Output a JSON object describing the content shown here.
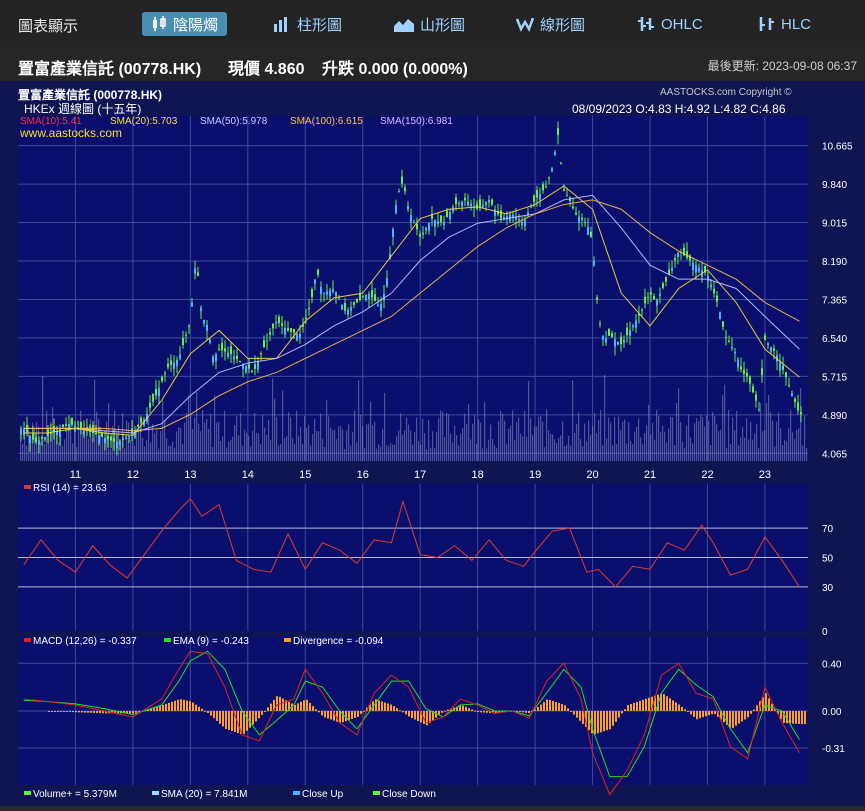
{
  "app": {
    "title": "圖表顯示"
  },
  "tabs": [
    {
      "label": "陰陽燭",
      "icon": "candlestick-icon",
      "active": true
    },
    {
      "label": "柱形圖",
      "icon": "bar-chart-icon",
      "active": false
    },
    {
      "label": "山形圖",
      "icon": "mountain-chart-icon",
      "active": false
    },
    {
      "label": "線形圖",
      "icon": "line-chart-icon",
      "active": false
    },
    {
      "label": "OHLC",
      "icon": "ohlc-icon",
      "active": false
    },
    {
      "label": "HLC",
      "icon": "hlc-icon",
      "active": false
    }
  ],
  "info": {
    "name": "置富產業信託 (00778.HK)",
    "price": "現價 4.860",
    "change": "升跌 0.000 (0.000%)",
    "updated": "最後更新: 2023-09-08 06:37"
  },
  "chart_header": {
    "title": "置富產業信託 (000778.HK)",
    "subtitle": "HKEx 週線圖 (十五年)",
    "source": "AASTOCKS.com Copyright ©",
    "website": "www.aastocks.com",
    "ohlc": "08/09/2023   O:4.83  H:4.92  L:4.82  C:4.86"
  },
  "colors": {
    "background": "#0f1550",
    "grid": "#3a4a9a",
    "candle": "#66ee44",
    "volume": "#8a8ab8",
    "sma10": "#ff3030",
    "sma20": "#ffdd33",
    "sma50": "#c8c8ff",
    "sma100": "#ffc040",
    "sma150": "#e0b0ff",
    "rsi": "#e03a2a",
    "macd": "#e02020",
    "ema": "#22dd22",
    "divergence": "#ffa020"
  },
  "chart_data": [
    {
      "type": "line",
      "panel": "price",
      "ylim": [
        3.9,
        11.3
      ],
      "yticks": [
        "10.665",
        "9.840",
        "9.015",
        "8.190",
        "7.365",
        "6.540",
        "5.715",
        "4.890",
        "4.065"
      ],
      "xticks": [
        "11",
        "12",
        "13",
        "14",
        "15",
        "16",
        "17",
        "18",
        "19",
        "20",
        "21",
        "22",
        "23"
      ],
      "legend": [
        "SMA(10):5.41",
        "SMA(20):5.703",
        "SMA(50):5.978",
        "SMA(100):6.615",
        "SMA(150):6.981"
      ],
      "series": [
        {
          "name": "Price",
          "x": [
            10.1,
            10.3,
            10.6,
            10.9,
            11.1,
            11.3,
            11.5,
            11.7,
            11.9,
            12.0,
            12.2,
            12.4,
            12.6,
            12.8,
            12.9,
            13.0,
            13.1,
            13.2,
            13.3,
            13.4,
            13.5,
            13.7,
            13.9,
            14.1,
            14.3,
            14.5,
            14.7,
            14.9,
            15.0,
            15.1,
            15.2,
            15.3,
            15.5,
            15.7,
            15.9,
            16.1,
            16.3,
            16.4,
            16.5,
            16.6,
            16.7,
            16.8,
            17.0,
            17.2,
            17.4,
            17.6,
            17.8,
            18.0,
            18.2,
            18.4,
            18.6,
            18.8,
            18.9,
            19.0,
            19.2,
            19.3,
            19.4,
            19.5,
            19.6,
            19.7,
            19.8,
            19.9,
            20.0,
            20.1,
            20.2,
            20.3,
            20.4,
            20.5,
            20.6,
            20.8,
            21.0,
            21.1,
            21.3,
            21.5,
            21.7,
            21.9,
            22.0,
            22.2,
            22.3,
            22.5,
            22.6,
            22.7,
            22.9,
            23.0,
            23.2,
            23.4,
            23.6
          ],
          "values": [
            4.6,
            4.3,
            4.5,
            4.7,
            4.6,
            4.5,
            4.4,
            4.3,
            4.4,
            4.5,
            4.8,
            5.3,
            5.9,
            6.1,
            6.5,
            6.9,
            8.3,
            7.0,
            6.8,
            6.1,
            6.3,
            6.2,
            6.0,
            5.8,
            6.4,
            6.9,
            6.7,
            6.6,
            6.9,
            7.3,
            8.0,
            7.5,
            7.6,
            7.1,
            7.3,
            7.5,
            7.2,
            7.6,
            8.6,
            9.6,
            9.9,
            9.3,
            8.7,
            9.1,
            9.0,
            9.4,
            9.5,
            9.3,
            9.5,
            9.1,
            9.2,
            9.0,
            9.3,
            9.5,
            9.8,
            10.2,
            10.9,
            9.7,
            9.5,
            9.2,
            9.1,
            9.0,
            8.6,
            7.0,
            6.5,
            6.6,
            6.5,
            6.4,
            6.6,
            7.0,
            7.5,
            7.3,
            7.8,
            8.4,
            8.2,
            8.0,
            7.9,
            7.2,
            6.6,
            6.2,
            5.8,
            5.7,
            5.0,
            6.5,
            6.2,
            5.6,
            4.9
          ]
        },
        {
          "name": "SMA(20)",
          "x": [
            10.1,
            10.5,
            11.0,
            11.5,
            12.0,
            12.5,
            13.0,
            13.5,
            14.0,
            14.5,
            15.0,
            15.5,
            16.0,
            16.5,
            17.0,
            17.5,
            18.0,
            18.5,
            19.0,
            19.5,
            20.0,
            20.5,
            21.0,
            21.5,
            22.0,
            22.5,
            23.0,
            23.6
          ],
          "values": [
            4.5,
            4.5,
            4.6,
            4.5,
            4.45,
            5.2,
            6.2,
            6.7,
            6.1,
            6.1,
            6.9,
            7.4,
            7.5,
            8.3,
            9.1,
            9.3,
            9.35,
            9.2,
            9.4,
            9.8,
            9.3,
            7.5,
            6.8,
            7.6,
            8.0,
            7.3,
            6.3,
            5.7
          ]
        },
        {
          "name": "SMA(50)",
          "x": [
            10.1,
            10.5,
            11.0,
            11.5,
            12.0,
            12.5,
            13.0,
            13.5,
            14.0,
            14.5,
            15.0,
            15.5,
            16.0,
            16.5,
            17.0,
            17.5,
            18.0,
            18.5,
            19.0,
            19.5,
            20.0,
            20.5,
            21.0,
            21.5,
            22.0,
            22.5,
            23.0,
            23.6
          ],
          "values": [
            4.6,
            4.6,
            4.6,
            4.55,
            4.5,
            4.7,
            5.3,
            5.8,
            6.0,
            6.1,
            6.4,
            6.8,
            7.1,
            7.5,
            8.2,
            8.7,
            9.0,
            9.1,
            9.2,
            9.5,
            9.6,
            8.9,
            8.1,
            7.8,
            7.8,
            7.6,
            7.0,
            6.3
          ]
        },
        {
          "name": "SMA(100)",
          "x": [
            10.1,
            10.5,
            11.0,
            11.5,
            12.0,
            12.5,
            13.0,
            13.5,
            14.0,
            14.5,
            15.0,
            15.5,
            16.0,
            16.5,
            17.0,
            17.5,
            18.0,
            18.5,
            19.0,
            19.5,
            20.0,
            20.5,
            21.0,
            21.5,
            22.0,
            22.5,
            23.0,
            23.6
          ],
          "values": [
            4.6,
            4.6,
            4.6,
            4.6,
            4.55,
            4.6,
            4.9,
            5.3,
            5.6,
            5.8,
            6.1,
            6.4,
            6.7,
            7.0,
            7.5,
            8.0,
            8.5,
            8.9,
            9.2,
            9.4,
            9.5,
            9.3,
            8.8,
            8.4,
            8.1,
            7.8,
            7.3,
            6.9
          ]
        }
      ]
    },
    {
      "type": "bar",
      "panel": "volume",
      "legend": [
        "Volume+ = 5.379M",
        "SMA (20) = 7.841M",
        "Close Up",
        "Close Down"
      ]
    },
    {
      "type": "line",
      "panel": "rsi",
      "title": "RSI (14) = 23.63",
      "ylim": [
        0,
        100
      ],
      "yticks": [
        "70",
        "50",
        "30",
        "0"
      ],
      "series": [
        {
          "name": "RSI (14)",
          "x": [
            10.1,
            10.4,
            10.7,
            11.0,
            11.3,
            11.6,
            11.9,
            12.2,
            12.5,
            12.8,
            13.0,
            13.2,
            13.5,
            13.8,
            14.1,
            14.4,
            14.7,
            15.0,
            15.3,
            15.6,
            15.9,
            16.2,
            16.5,
            16.7,
            17.0,
            17.3,
            17.6,
            17.9,
            18.2,
            18.5,
            18.8,
            19.0,
            19.3,
            19.6,
            19.9,
            20.1,
            20.4,
            20.7,
            21.0,
            21.3,
            21.6,
            21.9,
            22.1,
            22.4,
            22.7,
            23.0,
            23.3,
            23.6
          ],
          "values": [
            45,
            62,
            48,
            40,
            58,
            45,
            36,
            52,
            68,
            82,
            90,
            78,
            86,
            48,
            42,
            40,
            66,
            42,
            60,
            55,
            46,
            62,
            60,
            88,
            52,
            50,
            58,
            48,
            62,
            48,
            44,
            54,
            68,
            70,
            40,
            42,
            30,
            44,
            42,
            60,
            55,
            72,
            60,
            38,
            42,
            64,
            48,
            30
          ]
        }
      ]
    },
    {
      "type": "line",
      "panel": "macd",
      "title": "MACD (12,26) = -0.337",
      "ylim": [
        -0.62,
        0.62
      ],
      "yticks": [
        "0.40",
        "0.00",
        "-0.31"
      ],
      "legend": [
        "EMA (9) = -0.243",
        "Divergence = -0.094"
      ],
      "series": [
        {
          "name": "MACD (12,26)",
          "x": [
            10.1,
            10.5,
            11.0,
            11.5,
            12.0,
            12.5,
            12.8,
            13.0,
            13.3,
            13.6,
            13.9,
            14.2,
            14.5,
            14.8,
            15.0,
            15.3,
            15.6,
            15.9,
            16.2,
            16.5,
            16.8,
            17.1,
            17.4,
            17.7,
            18.0,
            18.3,
            18.6,
            18.9,
            19.2,
            19.5,
            19.8,
            20.0,
            20.3,
            20.6,
            20.9,
            21.2,
            21.5,
            21.8,
            22.1,
            22.4,
            22.7,
            23.0,
            23.3,
            23.6
          ],
          "values": [
            0.1,
            0.08,
            0.05,
            0.0,
            -0.05,
            0.1,
            0.35,
            0.5,
            0.48,
            0.2,
            -0.2,
            -0.25,
            0.05,
            0.1,
            0.35,
            0.15,
            -0.1,
            -0.2,
            0.15,
            0.3,
            0.2,
            -0.1,
            -0.05,
            0.1,
            0.05,
            -0.02,
            0.0,
            -0.06,
            0.25,
            0.4,
            0.1,
            -0.35,
            -0.7,
            -0.5,
            -0.2,
            0.3,
            0.4,
            0.15,
            0.1,
            -0.3,
            -0.4,
            0.2,
            -0.1,
            -0.35
          ]
        },
        {
          "name": "EMA (9)",
          "x": [
            10.1,
            10.5,
            11.0,
            11.5,
            12.0,
            12.5,
            12.8,
            13.0,
            13.3,
            13.6,
            13.9,
            14.2,
            14.5,
            14.8,
            15.0,
            15.3,
            15.6,
            15.9,
            16.2,
            16.5,
            16.8,
            17.1,
            17.4,
            17.7,
            18.0,
            18.3,
            18.6,
            18.9,
            19.2,
            19.5,
            19.8,
            20.0,
            20.3,
            20.6,
            20.9,
            21.2,
            21.5,
            21.8,
            22.1,
            22.4,
            22.7,
            23.0,
            23.3,
            23.6
          ],
          "values": [
            0.09,
            0.08,
            0.06,
            0.02,
            -0.03,
            0.05,
            0.25,
            0.42,
            0.5,
            0.35,
            0.0,
            -0.2,
            -0.08,
            0.05,
            0.25,
            0.2,
            0.0,
            -0.15,
            0.05,
            0.25,
            0.25,
            0.02,
            -0.05,
            0.05,
            0.06,
            0.0,
            0.0,
            -0.04,
            0.15,
            0.35,
            0.2,
            -0.15,
            -0.55,
            -0.55,
            -0.3,
            0.15,
            0.35,
            0.22,
            0.12,
            -0.15,
            -0.35,
            0.05,
            0.0,
            -0.24
          ]
        }
      ]
    }
  ]
}
